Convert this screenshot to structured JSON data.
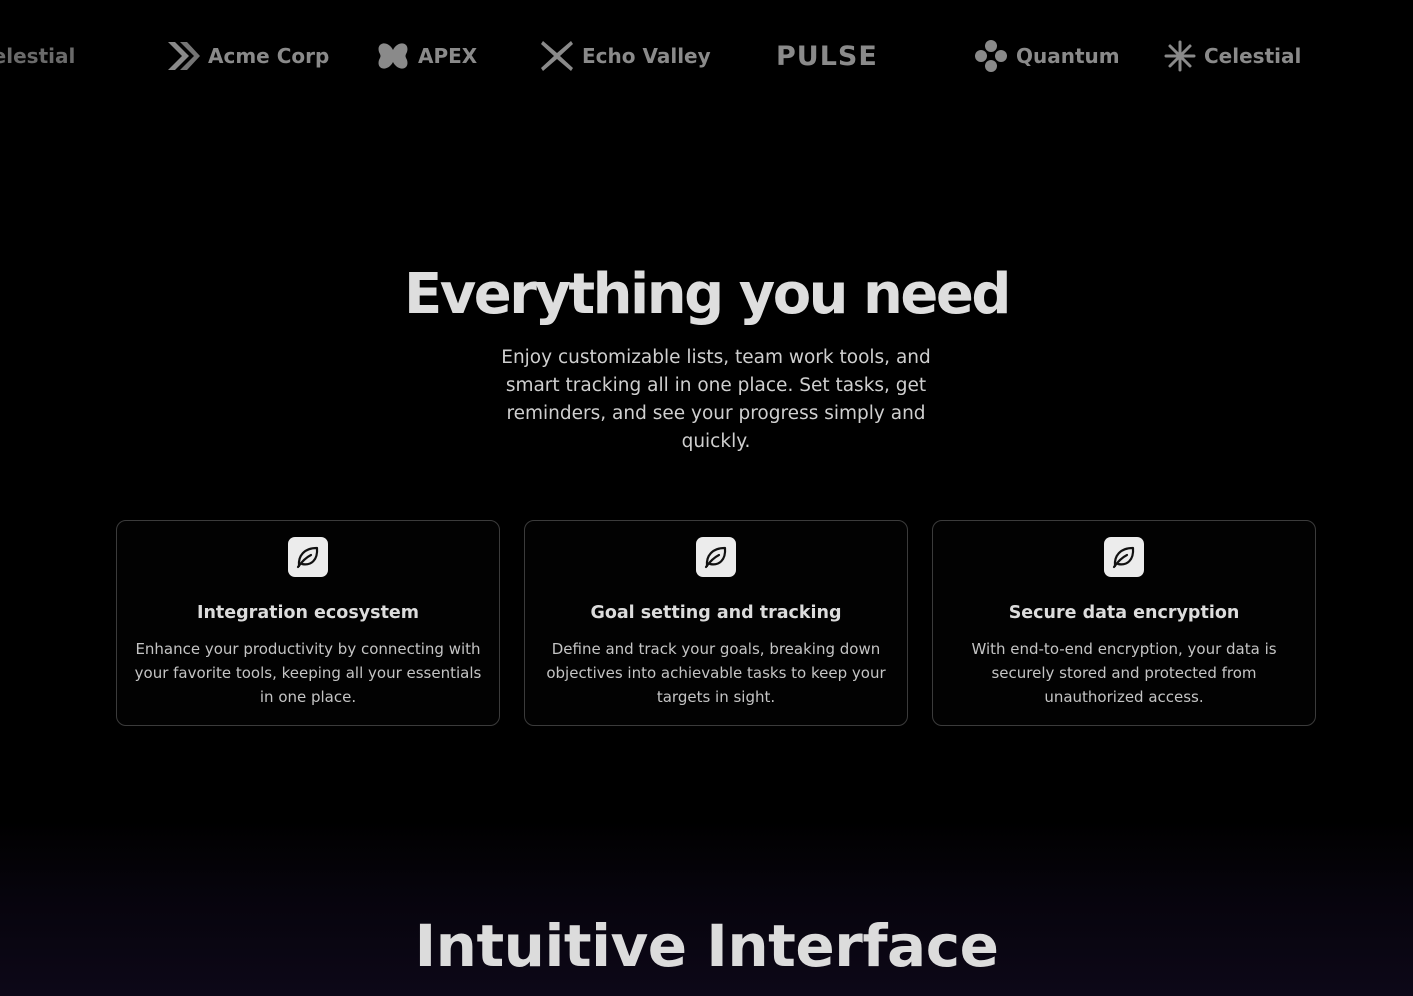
{
  "logos": [
    {
      "name": "Celestial",
      "icon": "star-burst-icon"
    },
    {
      "name": "Acme Corp",
      "icon": "double-chevron-icon"
    },
    {
      "name": "APEX",
      "icon": "clover-shape-icon"
    },
    {
      "name": "Echo Valley",
      "icon": "x-mark-icon"
    },
    {
      "name": "PULSE",
      "icon": ""
    },
    {
      "name": "Quantum",
      "icon": "four-dot-icon"
    },
    {
      "name": "Celestial",
      "icon": "star-burst-icon"
    }
  ],
  "features": {
    "title": "Everything you need",
    "subtitle": "Enjoy customizable lists, team work tools, and smart tracking all in one place. Set tasks, get reminders, and see your progress simply and quickly.",
    "cards": [
      {
        "icon": "leaf-icon",
        "title": "Integration ecosystem",
        "description": "Enhance your productivity by connecting with your favorite tools, keeping all your essentials in one place."
      },
      {
        "icon": "leaf-icon",
        "title": "Goal setting and tracking",
        "description": "Define and track your goals, breaking down objectives into achievable tasks to keep your targets in sight."
      },
      {
        "icon": "leaf-icon",
        "title": "Secure data encryption",
        "description": "With end-to-end encryption, your data is securely stored and protected from unauthorized access."
      }
    ]
  },
  "next_section": {
    "title": "Intuitive Interface"
  },
  "colors": {
    "background": "#000000",
    "card_border": "#3b3b3b",
    "icon_tile": "#ececec",
    "logo_gray": "#8a8a8a"
  }
}
